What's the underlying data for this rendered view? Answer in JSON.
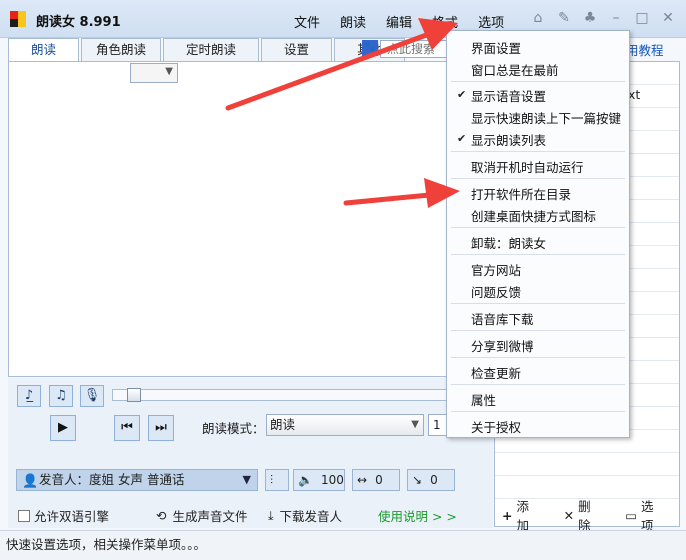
{
  "app": {
    "title": "朗读女 8.991",
    "logo_colors": [
      "#e8221a",
      "#f7c51e",
      "#1c1c1c",
      "#f7c51e"
    ]
  },
  "menu": {
    "items": [
      "文件",
      "朗读",
      "编辑",
      "格式",
      "选项"
    ]
  },
  "window_icons": [
    "home-icon",
    "tools-icon",
    "shirt-icon",
    "minimize-icon",
    "maximize-icon",
    "close-icon"
  ],
  "tabs": [
    "朗读",
    "角色朗读",
    "定时朗读",
    "设置",
    "其他"
  ],
  "search": {
    "placeholder": "点此搜索"
  },
  "help_link": "用教程",
  "right_panel": {
    "header_text": "xt",
    "add_label": "添加",
    "delete_label": "删除",
    "options_label": "选项"
  },
  "controls": {
    "mode_label": "朗读模式：",
    "mode_value": "朗读",
    "speed_value": "1",
    "voice_label": "发音人：度姐 女声 普通话",
    "volume": "100",
    "rate": "0",
    "pitch": "0",
    "dual_engine_label": "允许双语引擎",
    "generate_label": "生成声音文件",
    "download_label": "下载发音人",
    "usage_label": "使用说明 > >"
  },
  "status_text": "快速设置选项，相关操作菜单项。。。",
  "dropdown": {
    "groups": [
      [
        {
          "label": "界面设置",
          "checked": false
        },
        {
          "label": "窗口总是在最前",
          "checked": false
        }
      ],
      [
        {
          "label": "显示语音设置",
          "checked": true
        },
        {
          "label": "显示快速朗读上下一篇按键",
          "checked": false
        },
        {
          "label": "显示朗读列表",
          "checked": true
        }
      ],
      [
        {
          "label": "取消开机时自动运行",
          "checked": false
        }
      ],
      [
        {
          "label": "打开软件所在目录",
          "checked": false
        },
        {
          "label": "创建桌面快捷方式图标",
          "checked": false
        }
      ],
      [
        {
          "label": "卸载：朗读女",
          "checked": false
        }
      ],
      [
        {
          "label": "官方网站",
          "checked": false
        },
        {
          "label": "问题反馈",
          "checked": false
        }
      ],
      [
        {
          "label": "语音库下载",
          "checked": false
        }
      ],
      [
        {
          "label": "分享到微博",
          "checked": false
        }
      ],
      [
        {
          "label": "检查更新",
          "checked": false
        }
      ],
      [
        {
          "label": "属性",
          "checked": false
        }
      ],
      [
        {
          "label": "关于授权",
          "checked": false
        }
      ]
    ]
  },
  "accent_colors": {
    "arrow": "#f0403a",
    "link": "#1a56b8",
    "green": "#1a9a2c"
  }
}
